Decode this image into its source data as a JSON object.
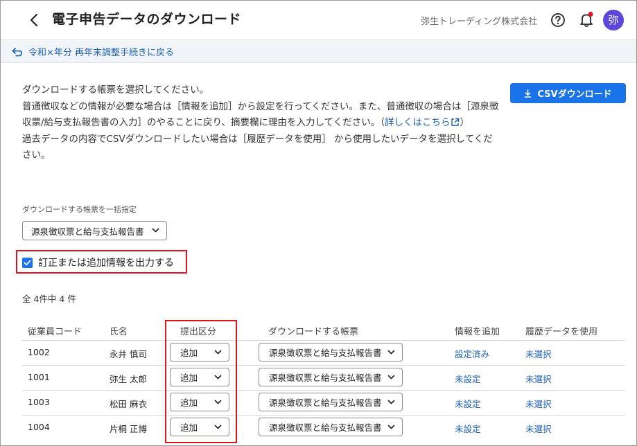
{
  "header": {
    "title": "電子申告データのダウンロード",
    "company": "弥生トレーディング株式会社",
    "avatar_text": "弥"
  },
  "subbar": {
    "return_link": "令和×年分 再年末調整手続きに戻る"
  },
  "description": {
    "line1": "ダウンロードする帳票を選択してください。",
    "line2": "普通徴収などの情報が必要な場合は［情報を追加］から設定を行ってください。また、普通徴収の場合は［源泉徴収票/給与支払報告書の入力］のやることに戻り、摘要欄に理由を入力してください。（",
    "details_link": "詳しくはこちら",
    "line2_end": "）",
    "line3": "過去データの内容でCSVダウンロードしたい場合は［履歴データを使用］ から使用したいデータを選択してください。"
  },
  "csv_button_label": "CSVダウンロード",
  "bulk": {
    "label": "ダウンロードする帳票を一括指定",
    "selected": "源泉徴収票と給与支払報告書"
  },
  "option": {
    "checkbox_label": "訂正または追加情報を出力する",
    "checked": true
  },
  "count_text": "全 4件中 4 件",
  "table": {
    "headers": [
      "従業員コード",
      "氏名",
      "提出区分",
      "ダウンロードする帳票",
      "情報を追加",
      "履歴データを使用"
    ],
    "rows": [
      {
        "code": "1002",
        "name": "永井 慎司",
        "type": "追加",
        "form": "源泉徴収票と給与支払報告書",
        "info": "設定済み",
        "history": "未選択"
      },
      {
        "code": "1001",
        "name": "弥生 太郎",
        "type": "追加",
        "form": "源泉徴収票と給与支払報告書",
        "info": "未設定",
        "history": "未選択"
      },
      {
        "code": "1003",
        "name": "松田 麻衣",
        "type": "追加",
        "form": "源泉徴収票と給与支払報告書",
        "info": "未設定",
        "history": "未選択"
      },
      {
        "code": "1004",
        "name": "片桐 正博",
        "type": "追加",
        "form": "源泉徴収票と給与支払報告書",
        "info": "未設定",
        "history": "未選択"
      }
    ]
  },
  "colors": {
    "accent": "#1a73e8",
    "link": "#1a5fb4",
    "highlight": "#e0141e",
    "avatar": "#5b48d8"
  }
}
